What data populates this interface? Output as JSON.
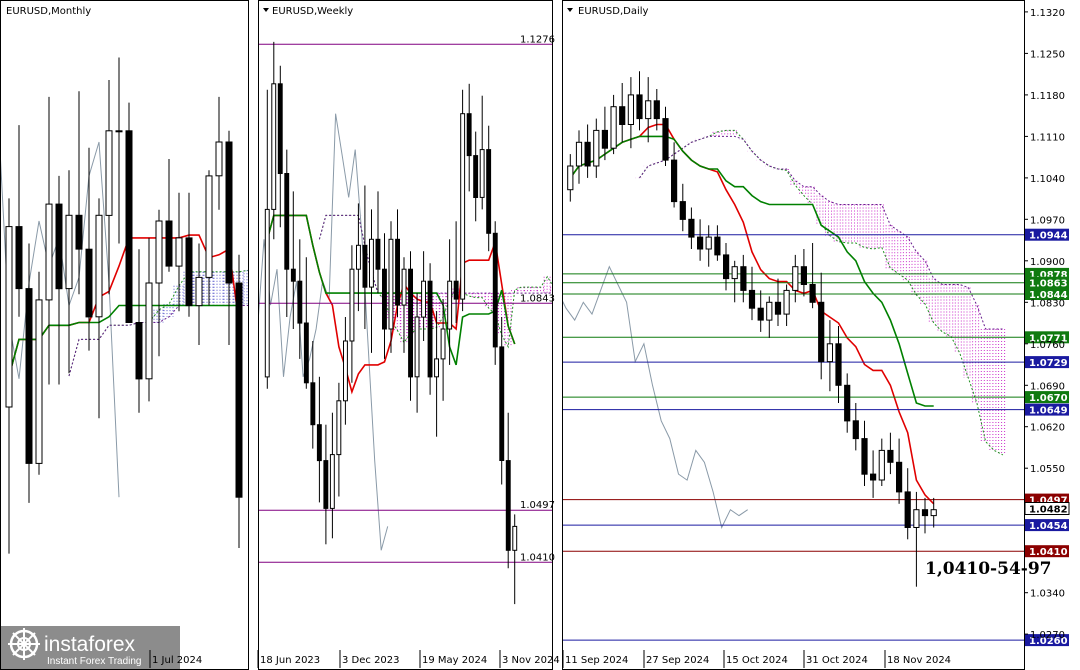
{
  "chart_data": [
    {
      "type": "candlestick",
      "title": "EURUSD,Monthly",
      "x_labels": [
        "1 Jul 2024"
      ],
      "ylim": [
        1.03,
        1.135
      ],
      "colors": {
        "tenkan": "#e00000",
        "kijun": "#008000",
        "cloud": "#3030c0"
      },
      "series": [
        {
          "candles": [
            [
              1.066,
              1.103,
              1.04,
              1.098
            ],
            [
              1.098,
              1.116,
              1.082,
              1.087
            ],
            [
              1.087,
              1.095,
              1.049,
              1.056
            ],
            [
              1.056,
              1.09,
              1.054,
              1.085
            ],
            [
              1.085,
              1.121,
              1.07,
              1.102
            ],
            [
              1.102,
              1.107,
              1.07,
              1.087
            ],
            [
              1.087,
              1.108,
              1.072,
              1.1
            ],
            [
              1.1,
              1.122,
              1.086,
              1.094
            ],
            [
              1.094,
              1.112,
              1.076,
              1.082
            ],
            [
              1.082,
              1.103,
              1.064,
              1.1
            ],
            [
              1.1,
              1.124,
              1.086,
              1.115
            ],
            [
              1.115,
              1.128,
              1.095,
              1.115
            ],
            [
              1.115,
              1.12,
              1.083,
              1.081
            ],
            [
              1.081,
              1.094,
              1.065,
              1.071
            ],
            [
              1.071,
              1.096,
              1.067,
              1.088
            ],
            [
              1.088,
              1.101,
              1.075,
              1.099
            ],
            [
              1.099,
              1.11,
              1.09,
              1.091
            ],
            [
              1.091,
              1.104,
              1.083,
              1.096
            ],
            [
              1.096,
              1.104,
              1.082,
              1.084
            ],
            [
              1.084,
              1.095,
              1.077,
              1.089
            ],
            [
              1.089,
              1.108,
              1.084,
              1.107
            ],
            [
              1.107,
              1.121,
              1.101,
              1.113
            ],
            [
              1.113,
              1.115,
              1.077,
              1.088
            ],
            [
              1.088,
              1.093,
              1.041,
              1.05
            ]
          ]
        }
      ]
    },
    {
      "type": "candlestick",
      "title": "EURUSD,Weekly",
      "x_labels": [
        "18 Jun 2023",
        "3 Dec 2023",
        "19 May 2024",
        "3 Nov 2024"
      ],
      "ylim": [
        1.028,
        1.132
      ],
      "levels": [
        {
          "value": 1.1276,
          "label": "1.1276",
          "color": "#800080"
        },
        {
          "value": 1.0843,
          "label": "1.0843",
          "color": "#800080"
        },
        {
          "value": 1.0497,
          "label": "1.0497",
          "color": "#800080"
        },
        {
          "value": 1.041,
          "label": "1.0410",
          "color": "#800080"
        }
      ],
      "series": [
        {
          "candles": [
            [
              1.072,
              1.12,
              1.07,
              1.1
            ],
            [
              1.1,
              1.128,
              1.095,
              1.121
            ],
            [
              1.121,
              1.124,
              1.097,
              1.106
            ],
            [
              1.106,
              1.11,
              1.082,
              1.09
            ],
            [
              1.09,
              1.103,
              1.08,
              1.088
            ],
            [
              1.088,
              1.095,
              1.075,
              1.081
            ],
            [
              1.081,
              1.092,
              1.07,
              1.071
            ],
            [
              1.071,
              1.078,
              1.06,
              1.064
            ],
            [
              1.064,
              1.072,
              1.051,
              1.058
            ],
            [
              1.058,
              1.064,
              1.044,
              1.05
            ],
            [
              1.05,
              1.066,
              1.045,
              1.059
            ],
            [
              1.059,
              1.071,
              1.052,
              1.068
            ],
            [
              1.068,
              1.082,
              1.064,
              1.078
            ],
            [
              1.078,
              1.094,
              1.071,
              1.09
            ],
            [
              1.09,
              1.101,
              1.083,
              1.094
            ],
            [
              1.094,
              1.104,
              1.08,
              1.087
            ],
            [
              1.087,
              1.1,
              1.076,
              1.095
            ],
            [
              1.095,
              1.103,
              1.086,
              1.09
            ],
            [
              1.09,
              1.096,
              1.075,
              1.08
            ],
            [
              1.08,
              1.098,
              1.076,
              1.095
            ],
            [
              1.095,
              1.1,
              1.082,
              1.084
            ],
            [
              1.084,
              1.092,
              1.076,
              1.09
            ],
            [
              1.09,
              1.093,
              1.068,
              1.072
            ],
            [
              1.072,
              1.086,
              1.066,
              1.082
            ],
            [
              1.082,
              1.093,
              1.078,
              1.088
            ],
            [
              1.088,
              1.091,
              1.069,
              1.072
            ],
            [
              1.072,
              1.083,
              1.062,
              1.075
            ],
            [
              1.075,
              1.085,
              1.068,
              1.08
            ],
            [
              1.08,
              1.095,
              1.074,
              1.088
            ],
            [
              1.088,
              1.098,
              1.081,
              1.085
            ],
            [
              1.085,
              1.12,
              1.083,
              1.116
            ],
            [
              1.116,
              1.121,
              1.103,
              1.109
            ],
            [
              1.109,
              1.113,
              1.098,
              1.102
            ],
            [
              1.102,
              1.119,
              1.1,
              1.11
            ],
            [
              1.11,
              1.114,
              1.093,
              1.096
            ],
            [
              1.096,
              1.098,
              1.074,
              1.077
            ],
            [
              1.077,
              1.082,
              1.054,
              1.058
            ],
            [
              1.058,
              1.066,
              1.04,
              1.043
            ],
            [
              1.043,
              1.049,
              1.034,
              1.047
            ]
          ]
        }
      ]
    },
    {
      "type": "candlestick",
      "title": "EURUSD,Daily",
      "x_labels": [
        "11 Sep 2024",
        "27 Sep 2024",
        "15 Oct 2024",
        "31 Oct 2024",
        "18 Nov 2024"
      ],
      "yticks": [
        "1.1320",
        "1.1250",
        "1.1180",
        "1.1110",
        "1.1040",
        "1.0970",
        "1.0900",
        "1.0830",
        "1.0760",
        "1.0690",
        "1.0620",
        "1.0550",
        "1.0340",
        "1.0270"
      ],
      "ylim": [
        1.025,
        1.133
      ],
      "levels": [
        {
          "value": 1.0944,
          "label": "1.0944",
          "color": "#1a1aa0"
        },
        {
          "value": 1.0878,
          "label": "1.0878",
          "color": "#0f7a0f"
        },
        {
          "value": 1.0863,
          "label": "1.0863",
          "color": "#0f7a0f"
        },
        {
          "value": 1.0844,
          "label": "1.0844",
          "color": "#0f7a0f"
        },
        {
          "value": 1.0771,
          "label": "1.0771",
          "color": "#0f7a0f"
        },
        {
          "value": 1.0729,
          "label": "1.0729",
          "color": "#1a1aa0"
        },
        {
          "value": 1.067,
          "label": "1.0670",
          "color": "#0f7a0f"
        },
        {
          "value": 1.0649,
          "label": "1.0649",
          "color": "#1a1aa0"
        },
        {
          "value": 1.0497,
          "label": "1.0497",
          "color": "#8b0000"
        },
        {
          "value": 1.0454,
          "label": "1.0454",
          "color": "#1a1aa0"
        },
        {
          "value": 1.041,
          "label": "1.0410",
          "color": "#8b0000"
        },
        {
          "value": 1.026,
          "label": "1.0260",
          "color": "#1a1aa0"
        }
      ],
      "price_label": "1.0482",
      "annotation": "1,0410-54-97",
      "series": [
        {
          "candles": [
            [
              1.102,
              1.108,
              1.1,
              1.106
            ],
            [
              1.106,
              1.112,
              1.103,
              1.11
            ],
            [
              1.11,
              1.113,
              1.104,
              1.106
            ],
            [
              1.106,
              1.114,
              1.104,
              1.112
            ],
            [
              1.112,
              1.116,
              1.107,
              1.109
            ],
            [
              1.109,
              1.118,
              1.108,
              1.116
            ],
            [
              1.116,
              1.12,
              1.11,
              1.113
            ],
            [
              1.113,
              1.121,
              1.109,
              1.118
            ],
            [
              1.118,
              1.122,
              1.112,
              1.114
            ],
            [
              1.114,
              1.121,
              1.11,
              1.117
            ],
            [
              1.117,
              1.119,
              1.112,
              1.114
            ],
            [
              1.114,
              1.116,
              1.106,
              1.107
            ],
            [
              1.107,
              1.11,
              1.099,
              1.1
            ],
            [
              1.1,
              1.103,
              1.095,
              1.097
            ],
            [
              1.097,
              1.099,
              1.092,
              1.094
            ],
            [
              1.094,
              1.097,
              1.09,
              1.092
            ],
            [
              1.092,
              1.096,
              1.089,
              1.094
            ],
            [
              1.094,
              1.096,
              1.09,
              1.091
            ],
            [
              1.091,
              1.093,
              1.085,
              1.087
            ],
            [
              1.087,
              1.09,
              1.083,
              1.089
            ],
            [
              1.089,
              1.091,
              1.083,
              1.085
            ],
            [
              1.085,
              1.089,
              1.08,
              1.082
            ],
            [
              1.082,
              1.085,
              1.078,
              1.08
            ],
            [
              1.08,
              1.084,
              1.077,
              1.083
            ],
            [
              1.083,
              1.087,
              1.079,
              1.081
            ],
            [
              1.081,
              1.086,
              1.079,
              1.085
            ],
            [
              1.085,
              1.091,
              1.083,
              1.089
            ],
            [
              1.089,
              1.092,
              1.084,
              1.086
            ],
            [
              1.086,
              1.093,
              1.082,
              1.083
            ],
            [
              1.083,
              1.088,
              1.07,
              1.073
            ],
            [
              1.073,
              1.08,
              1.068,
              1.076
            ],
            [
              1.076,
              1.079,
              1.066,
              1.069
            ],
            [
              1.069,
              1.071,
              1.061,
              1.063
            ],
            [
              1.063,
              1.066,
              1.058,
              1.06
            ],
            [
              1.06,
              1.063,
              1.052,
              1.054
            ],
            [
              1.054,
              1.058,
              1.05,
              1.053
            ],
            [
              1.053,
              1.06,
              1.052,
              1.058
            ],
            [
              1.058,
              1.061,
              1.054,
              1.056
            ],
            [
              1.056,
              1.06,
              1.049,
              1.051
            ],
            [
              1.051,
              1.055,
              1.043,
              1.045
            ],
            [
              1.045,
              1.051,
              1.035,
              1.048
            ],
            [
              1.048,
              1.05,
              1.044,
              1.047
            ],
            [
              1.047,
              1.05,
              1.045,
              1.048
            ]
          ]
        }
      ]
    }
  ],
  "watermark": {
    "brand": "instaforex",
    "tagline": "Instant Forex Trading"
  }
}
